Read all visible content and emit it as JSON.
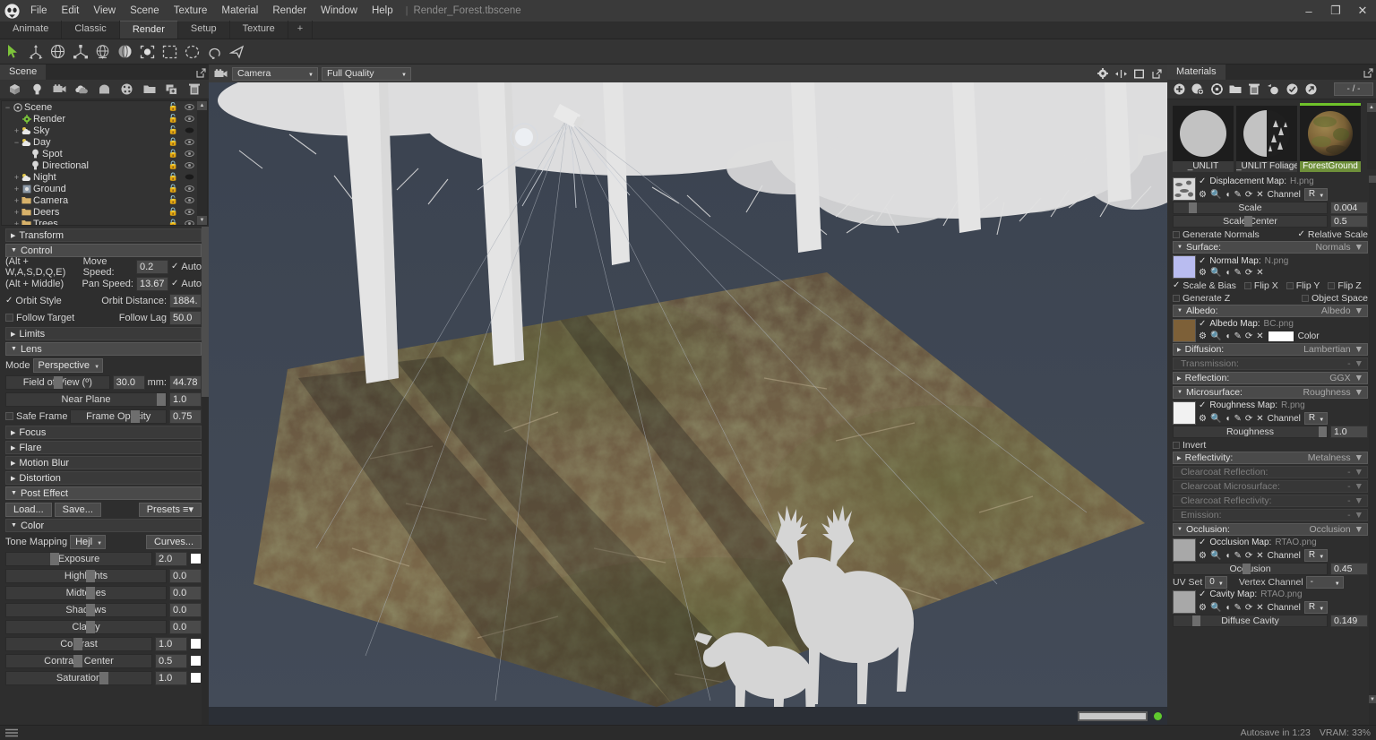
{
  "app": {
    "logo": "marmoset-logo",
    "menus": [
      "File",
      "Edit",
      "View",
      "Scene",
      "Texture",
      "Material",
      "Render",
      "Window",
      "Help"
    ],
    "separator": "|",
    "filename": "Render_Forest.tbscene",
    "window_buttons": {
      "minimize": "–",
      "maximize": "❐",
      "close": "✕"
    }
  },
  "layout_tabs": [
    {
      "label": "Animate",
      "active": false
    },
    {
      "label": "Classic",
      "active": false
    },
    {
      "label": "Render",
      "active": true
    },
    {
      "label": "Setup",
      "active": false
    },
    {
      "label": "Texture",
      "active": false
    },
    {
      "label": "+",
      "active": false
    }
  ],
  "main_toolbar": [
    {
      "name": "select-tool",
      "active": true
    },
    {
      "name": "move-tool",
      "active": false
    },
    {
      "name": "rotate-tool",
      "active": false
    },
    {
      "name": "scale-tool",
      "active": false
    },
    {
      "name": "transform-tool",
      "active": false
    },
    {
      "name": "pivot-tool",
      "active": false
    },
    {
      "name": "object-select-mode",
      "active": false
    },
    {
      "name": "rectangle-select-mode",
      "active": false
    },
    {
      "name": "ellipse-select-mode",
      "active": false
    },
    {
      "name": "lasso-select-mode",
      "active": false
    },
    {
      "name": "polygon-select-mode",
      "active": false
    }
  ],
  "left_panel": {
    "tab": "Scene",
    "popout": "popout-icon",
    "outliner_toolbar": [
      "add-mesh-icon",
      "add-light-icon",
      "add-camera-icon",
      "add-sky-icon",
      "add-fog-icon",
      "add-material-icon",
      "new-folder-icon",
      "duplicate-icon",
      "delete-icon"
    ],
    "outliner": [
      {
        "label": "Scene",
        "depth": 0,
        "twisty": "−",
        "icon": "scene-icon",
        "lock": "unlocked",
        "vis": "visible"
      },
      {
        "label": "Render",
        "depth": 1,
        "twisty": "",
        "icon": "render-icon",
        "lock": "unlocked",
        "vis": "visible"
      },
      {
        "label": "Sky",
        "depth": 1,
        "twisty": "+",
        "icon": "sky-icon",
        "lock": "unlocked",
        "vis": "hidden"
      },
      {
        "label": "Day",
        "depth": 1,
        "twisty": "−",
        "icon": "sky-icon",
        "lock": "locked",
        "vis": "visible"
      },
      {
        "label": "Spot",
        "depth": 2,
        "twisty": "",
        "icon": "light-icon",
        "lock": "locked",
        "vis": "visible"
      },
      {
        "label": "Directional",
        "depth": 2,
        "twisty": "",
        "icon": "light-icon",
        "lock": "locked",
        "vis": "visible"
      },
      {
        "label": "Night",
        "depth": 1,
        "twisty": "+",
        "icon": "sky-icon",
        "lock": "locked",
        "vis": "hidden"
      },
      {
        "label": "Ground",
        "depth": 1,
        "twisty": "+",
        "icon": "mesh-icon",
        "lock": "locked",
        "vis": "visible"
      },
      {
        "label": "Camera",
        "depth": 1,
        "twisty": "+",
        "icon": "folder-icon",
        "lock": "unlocked",
        "vis": "visible"
      },
      {
        "label": "Deers",
        "depth": 1,
        "twisty": "+",
        "icon": "folder-icon",
        "lock": "locked",
        "vis": "visible"
      },
      {
        "label": "Trees",
        "depth": 1,
        "twisty": "+",
        "icon": "folder-icon",
        "lock": "locked",
        "vis": "visible"
      }
    ],
    "sections": {
      "transform": "Transform",
      "control": "Control",
      "limits": "Limits",
      "lens": "Lens",
      "focus": "Focus",
      "flare": "Flare",
      "motion_blur": "Motion Blur",
      "distortion": "Distortion",
      "post_effect": "Post Effect",
      "color": "Color"
    },
    "control": {
      "move_hint": "(Alt + W,A,S,D,Q,E)",
      "move_speed_label": "Move Speed:",
      "move_speed_value": "0.2",
      "move_auto": "Auto",
      "pan_hint": "(Alt + Middle)",
      "pan_speed_label": "Pan Speed:",
      "pan_speed_value": "13.67",
      "pan_auto": "Auto",
      "orbit_style": "Orbit Style",
      "orbit_distance_label": "Orbit Distance:",
      "orbit_distance_value": "1884.",
      "follow_target": "Follow Target",
      "follow_lag_label": "Follow Lag",
      "follow_lag_value": "50.0"
    },
    "lens": {
      "mode_label": "Mode",
      "mode_value": "Perspective",
      "fov_label": "Field of View (º)",
      "fov_value": "30.0",
      "mm_label": "mm:",
      "mm_value": "44.78",
      "near_plane_label": "Near Plane",
      "near_plane_value": "1.0",
      "safe_frame": "Safe Frame",
      "frame_opacity_label": "Frame Opacity",
      "frame_opacity_value": "0.75"
    },
    "post_effect": {
      "load": "Load...",
      "save": "Save...",
      "presets": "Presets",
      "tone_mapping_label": "Tone Mapping",
      "tone_mapping_value": "Hejl",
      "curves": "Curves...",
      "params": [
        {
          "label": "Exposure",
          "value": "2.0",
          "swatch": "#ffffff",
          "knob": 0.3
        },
        {
          "label": "Highlights",
          "value": "0.0",
          "swatch": null,
          "knob": 0.5
        },
        {
          "label": "Midtones",
          "value": "0.0",
          "swatch": null,
          "knob": 0.5
        },
        {
          "label": "Shadows",
          "value": "0.0",
          "swatch": null,
          "knob": 0.5
        },
        {
          "label": "Clarity",
          "value": "0.0",
          "swatch": null,
          "knob": 0.5
        },
        {
          "label": "Contrast",
          "value": "1.0",
          "swatch": "#ffffff",
          "knob": 0.46
        },
        {
          "label": "Contrast Center",
          "value": "0.5",
          "swatch": "#ffffff",
          "knob": 0.46
        },
        {
          "label": "Saturation",
          "value": "1.0",
          "swatch": "#ffffff",
          "knob": 0.64
        }
      ]
    }
  },
  "viewport": {
    "camera_icon": "camera-icon",
    "camera_select": "Camera",
    "quality_select": "Full Quality",
    "right_icons": [
      "gear-icon",
      "snap-icon",
      "aspect-icon",
      "popout-icon"
    ],
    "progress_led": "#5fc92e"
  },
  "right_panel": {
    "tab": "Materials",
    "popout": "popout-icon",
    "toolbar": [
      "add-material-icon",
      "duplicate-material-icon",
      "clear-material-icon",
      "folder-icon",
      "delete-icon",
      "pick-material-icon",
      "assign-icon",
      "export-icon"
    ],
    "count": "- / -",
    "materials": [
      {
        "name": "_UNLIT",
        "selected": false,
        "kind": "flat-grey"
      },
      {
        "name": "_UNLIT Foliage",
        "selected": false,
        "kind": "foliage"
      },
      {
        "name": "ForestGround",
        "selected": true,
        "kind": "ground"
      }
    ],
    "displacement": {
      "map_label": "Displacement Map:",
      "map_file": "H.png",
      "channel_label": "Channel",
      "channel_value": "R",
      "scale_label": "Scale",
      "scale_value": "0.004",
      "scale_knob": 0.1,
      "scale_center_label": "Scale Center",
      "scale_center_value": "0.5",
      "scale_center_knob": 0.46,
      "generate_normals": "Generate Normals",
      "relative_scale": "Relative Scale"
    },
    "surface": {
      "header": "Surface:",
      "mode": "Normals",
      "map_label": "Normal Map:",
      "map_file": "N.png",
      "scale_bias": "Scale & Bias",
      "flip_x": "Flip X",
      "flip_y": "Flip Y",
      "flip_z": "Flip Z",
      "generate_z": "Generate Z",
      "object_space": "Object Space"
    },
    "albedo": {
      "header": "Albedo:",
      "mode": "Albedo",
      "map_label": "Albedo Map:",
      "map_file": "BC.png",
      "color_label": "Color",
      "color_value": "#ffffff"
    },
    "simple_sections": [
      {
        "header": "Diffusion:",
        "mode": "Lambertian",
        "dim": false
      },
      {
        "header": "Transmission:",
        "mode": "-",
        "dim": true
      },
      {
        "header": "Reflection:",
        "mode": "GGX",
        "dim": false
      }
    ],
    "microsurface": {
      "header": "Microsurface:",
      "mode": "Roughness",
      "map_label": "Roughness Map:",
      "map_file": "R.png",
      "channel_label": "Channel",
      "channel_value": "R",
      "rough_label": "Roughness",
      "rough_value": "1.0",
      "rough_knob": 0.93,
      "invert": "Invert"
    },
    "simple_sections2": [
      {
        "header": "Reflectivity:",
        "mode": "Metalness",
        "dim": false
      },
      {
        "header": "Clearcoat Reflection:",
        "mode": "-",
        "dim": true
      },
      {
        "header": "Clearcoat Microsurface:",
        "mode": "-",
        "dim": true
      },
      {
        "header": "Clearcoat Reflectivity:",
        "mode": "-",
        "dim": true
      },
      {
        "header": "Emission:",
        "mode": "-",
        "dim": true
      }
    ],
    "occlusion": {
      "header": "Occlusion:",
      "mode": "Occlusion",
      "map_label": "Occlusion Map:",
      "map_file": "RTAO.png",
      "channel_label": "Channel",
      "channel_value": "R",
      "occ_label": "Occlusion",
      "occ_value": "0.45",
      "occ_knob": 0.45,
      "uv_set_label": "UV Set",
      "uv_set_value": "0",
      "vertex_channel_label": "Vertex Channel",
      "vertex_channel_value": "-",
      "cavity_map_label": "Cavity Map:",
      "cavity_map_file": "RTAO.png",
      "cavity_channel_label": "Channel",
      "cavity_channel_value": "R",
      "diffuse_cavity_label": "Diffuse Cavity",
      "diffuse_cavity_value": "0.149",
      "diffuse_cavity_knob": 0.12
    }
  },
  "status_bar": {
    "autosave": "Autosave in 1:23",
    "vram": "VRAM: 33%"
  }
}
